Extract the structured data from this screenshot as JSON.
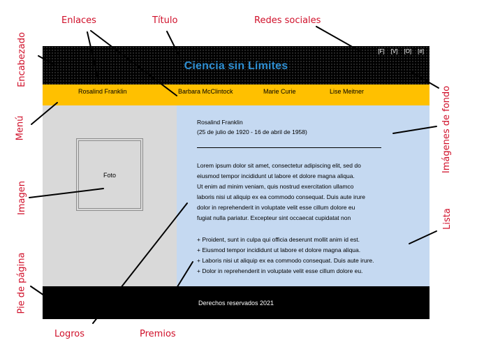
{
  "header": {
    "title": "Ciencia sin Límites",
    "social": [
      "[F]",
      "[V]",
      "[O]",
      "[#]"
    ]
  },
  "menu": {
    "links": [
      "Rosalind Franklin",
      "Barbara McClintock",
      "Marie Curie",
      "Lise Meitner"
    ]
  },
  "photo": {
    "label": "Foto"
  },
  "content": {
    "name": "Rosalind Franklin",
    "dates": "(25 de julio de 1920 - 16 de abril de 1958)",
    "paragraph": [
      "Lorem ipsum dolor sit amet, consectetur adipiscing elit, sed do",
      "eiusmod tempor incididunt ut labore et dolore magna aliqua.",
      "Ut enim ad minim veniam, quis nostrud exercitation ullamco",
      "laboris nisi ut aliquip ex ea commodo consequat. Duis aute irure",
      "dolor in reprehenderit in voluptate velit esse cillum dolore eu",
      "fugiat nulla pariatur. Excepteur sint occaecat cupidatat non"
    ],
    "list": [
      "+ Proident, sunt in culpa qui officia deserunt mollit anim id est.",
      "+ Eiusmod tempor incididunt ut labore et dolore magna aliqua.",
      "+ Laboris nisi ut aliquip ex ea commodo consequat. Duis aute irure.",
      "+ Dolor in reprehenderit in voluptate velit esse cillum dolore eu."
    ]
  },
  "footer": {
    "text": "Derechos reservados 2021"
  },
  "annotations": {
    "enlaces": "Enlaces",
    "titulo": "Título",
    "redes": "Redes sociales",
    "encabezado": "Encabezado",
    "imagenes_fondo": "Imágenes de fondo",
    "menu": "Menú",
    "imagen": "Imagen",
    "lista": "Lista",
    "pie": "Pie de página",
    "logros": "Logros",
    "premios": "Premios"
  },
  "colors": {
    "annotation": "#d0102a",
    "menu_bg": "#ffc000",
    "title": "#2e8fd3",
    "content_bg": "#c5d9f1",
    "sidebar_bg": "#d9d9d9"
  }
}
